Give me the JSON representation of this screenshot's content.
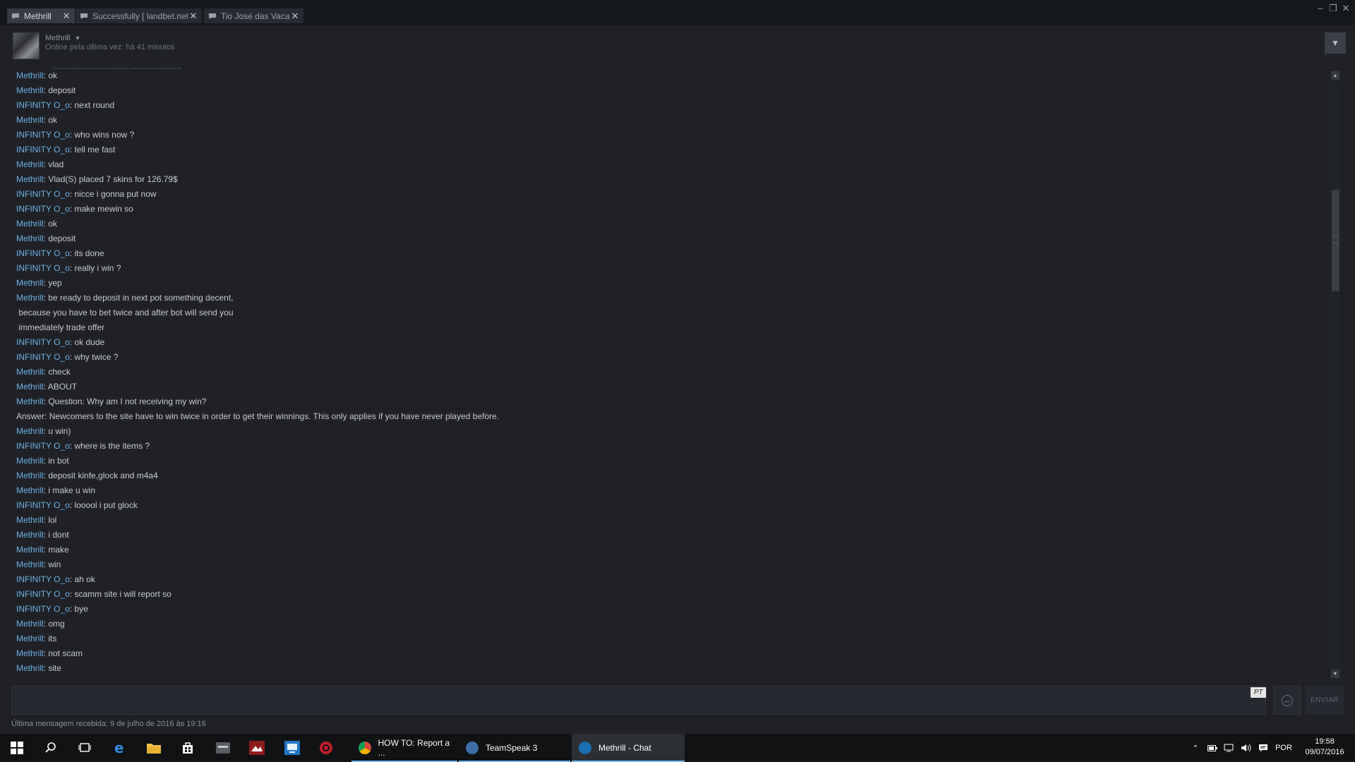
{
  "tabs": [
    {
      "label": "Methrill",
      "active": true
    },
    {
      "label": "Successfully [ landbet.net ]",
      "active": false
    },
    {
      "label": "Tio José das Vacas",
      "active": false
    }
  ],
  "window_controls": {
    "minimize": "–",
    "restore": "❐",
    "close": "✕"
  },
  "header": {
    "username": "Methrill",
    "status": "Online pela última vez: há 41 minutos",
    "menu_glyph": "▼"
  },
  "messages": [
    {
      "author": "Methrill",
      "text": "ok"
    },
    {
      "author": "Methrill",
      "text": "deposit"
    },
    {
      "author": "INFINITY O_o",
      "text": "next round"
    },
    {
      "author": "Methrill",
      "text": "ok"
    },
    {
      "author": "INFINITY O_o",
      "text": "who wins now ?"
    },
    {
      "author": "INFINITY O_o",
      "text": "tell me fast"
    },
    {
      "author": "Methrill",
      "text": "vlad"
    },
    {
      "author": "Methrill",
      "text": "Vlad(S) placed 7 skins for 126.79$"
    },
    {
      "author": "INFINITY O_o",
      "text": "nicce i gonna put now"
    },
    {
      "author": "INFINITY O_o",
      "text": "make mewin so"
    },
    {
      "author": "Methrill",
      "text": "ok"
    },
    {
      "author": "Methrill",
      "text": "deposit"
    },
    {
      "author": "INFINITY O_o",
      "text": "its done"
    },
    {
      "author": "INFINITY O_o",
      "text": "really i win ?"
    },
    {
      "author": "Methrill",
      "text": "yep"
    },
    {
      "author": "Methrill",
      "text": "be ready to deposit in next pot something decent,"
    },
    {
      "author": "",
      "text": " because you have to bet twice and after bot will send you"
    },
    {
      "author": "",
      "text": " immediately trade offer"
    },
    {
      "author": "INFINITY O_o",
      "text": "ok dude"
    },
    {
      "author": "INFINITY O_o",
      "text": "why twice ?"
    },
    {
      "author": "Methrill",
      "text": "check"
    },
    {
      "author": "Methrill",
      "text": "ABOUT"
    },
    {
      "author": "Methrill",
      "text": "Question: Why am I not receiving my win?"
    },
    {
      "author": "Answer",
      "plain": true,
      "text": "Newcomers to the site have to win twice in order to get their winnings. This only applies if you have never played before."
    },
    {
      "author": "Methrill",
      "text": "u win)"
    },
    {
      "author": "INFINITY O_o",
      "text": "where is the items ?"
    },
    {
      "author": "Methrill",
      "text": "in bot"
    },
    {
      "author": "Methrill",
      "text": "deposit kinfe,glock and m4a4"
    },
    {
      "author": "Methrill",
      "text": "i make u win"
    },
    {
      "author": "INFINITY O_o",
      "text": "looool i put glock"
    },
    {
      "author": "Methrill",
      "text": "lol"
    },
    {
      "author": "Methrill",
      "text": "i dont"
    },
    {
      "author": "Methrill",
      "text": "make"
    },
    {
      "author": "Methrill",
      "text": "win"
    },
    {
      "author": "INFINITY O_o",
      "text": "ah ok"
    },
    {
      "author": "INFINITY O_o",
      "text": "scamm site i will report so"
    },
    {
      "author": "INFINITY O_o",
      "text": "bye"
    },
    {
      "author": "Methrill",
      "text": "omg"
    },
    {
      "author": "Methrill",
      "text": "its"
    },
    {
      "author": "Methrill",
      "text": "not scam"
    },
    {
      "author": "Methrill",
      "text": "site"
    }
  ],
  "input": {
    "value": "",
    "language_badge": "PT",
    "send_label": "ENVIAR"
  },
  "footer": {
    "last_message": "Última mensagem recebida: 9 de julho de 2016 às 19:16"
  },
  "taskbar": {
    "apps": [
      {
        "label": "HOW TO: Report a ...",
        "icon": "chrome-icon",
        "color": "#e0a21b"
      },
      {
        "label": "TeamSpeak 3",
        "icon": "teamspeak-icon",
        "color": "#3d6fa7"
      },
      {
        "label": "Methrill - Chat",
        "icon": "steam-icon",
        "color": "#1b6fb0"
      }
    ],
    "language": "POR",
    "time": "19:58",
    "date": "09/07/2016"
  },
  "colors": {
    "author": "#6db3e8",
    "text": "#c7cbd1",
    "background": "#1f2126"
  }
}
